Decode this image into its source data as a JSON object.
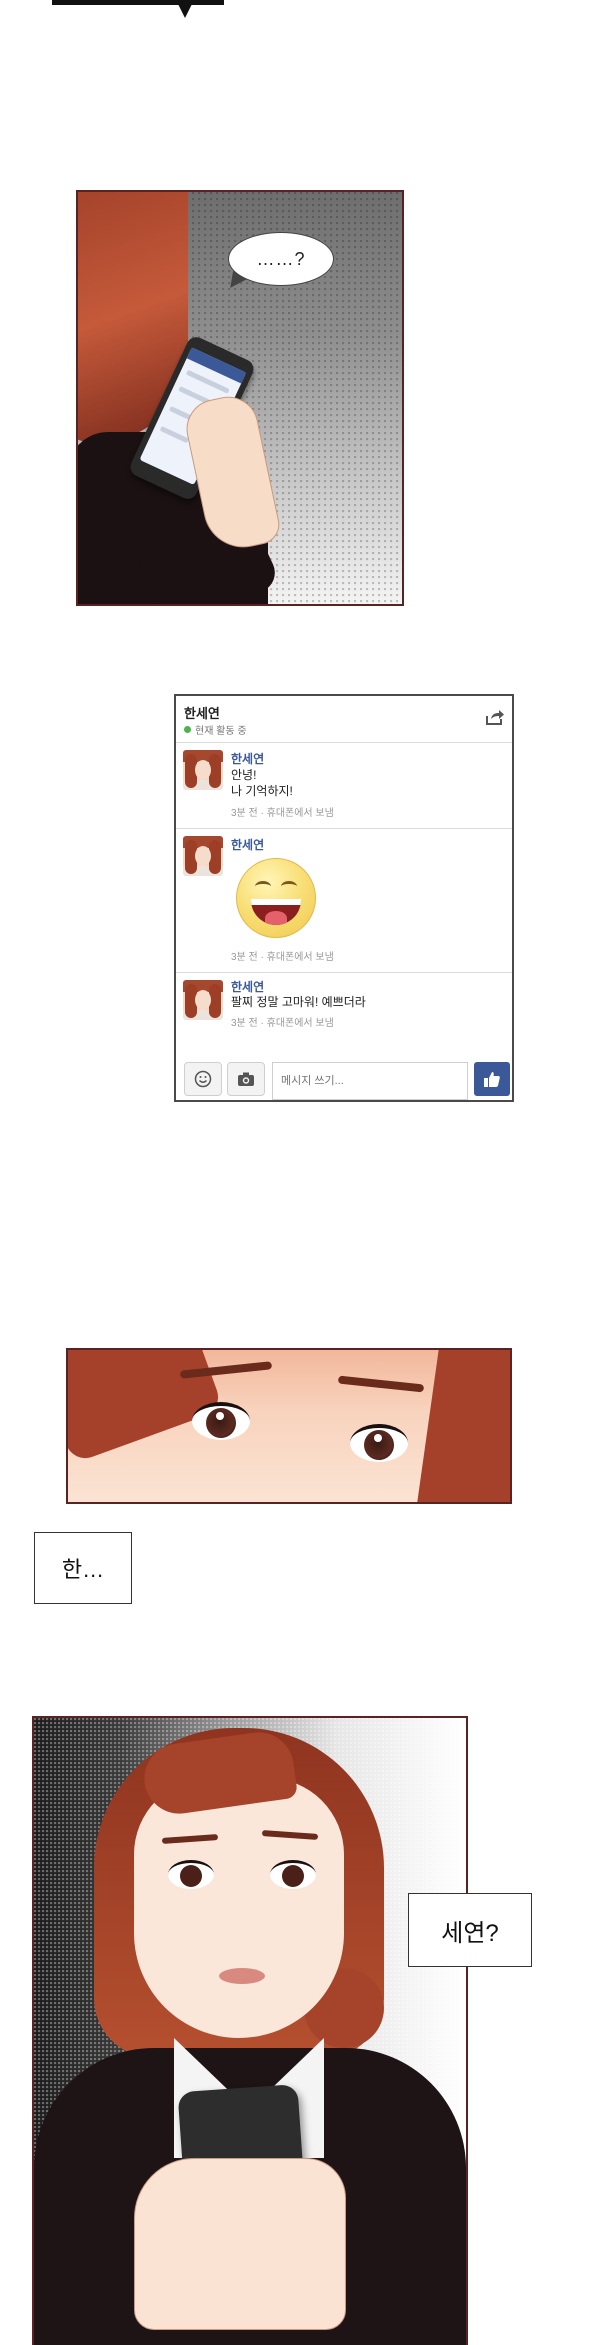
{
  "panel1": {
    "thought_text": "……?"
  },
  "chat": {
    "contact_name": "한세연",
    "status": "현재 활동 중",
    "messages": [
      {
        "sender": "한세연",
        "lines": [
          "안녕!",
          "나 기억하지!"
        ],
        "meta": "3분 전 · 휴대폰에서 보냄"
      },
      {
        "sender": "한세연",
        "emoji": "grinning-face",
        "meta": "3분 전 · 휴대폰에서 보냄"
      },
      {
        "sender": "한세연",
        "lines": [
          "팔찌 정말 고마워! 예쁘더라"
        ],
        "meta": "3분 전 · 휴대폰에서 보냄"
      }
    ],
    "compose_placeholder": "메시지 쓰기...",
    "icons": [
      "share-icon",
      "smiley-icon",
      "camera-icon",
      "like-icon"
    ],
    "accent_color": "#3b5998"
  },
  "captions": {
    "han": "한…",
    "seyeon": "세연?"
  }
}
